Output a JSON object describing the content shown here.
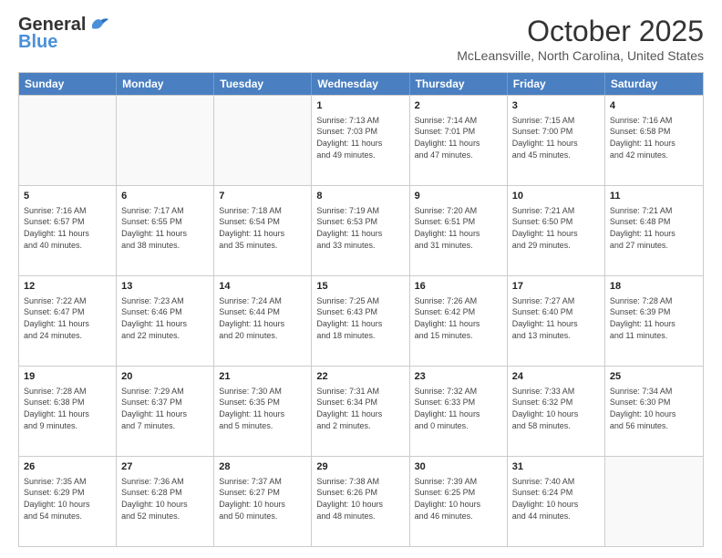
{
  "header": {
    "logo_line1": "General",
    "logo_line2": "Blue",
    "month_title": "October 2025",
    "location": "McLeansville, North Carolina, United States"
  },
  "weekdays": [
    "Sunday",
    "Monday",
    "Tuesday",
    "Wednesday",
    "Thursday",
    "Friday",
    "Saturday"
  ],
  "rows": [
    [
      {
        "day": "",
        "info": ""
      },
      {
        "day": "",
        "info": ""
      },
      {
        "day": "",
        "info": ""
      },
      {
        "day": "1",
        "info": "Sunrise: 7:13 AM\nSunset: 7:03 PM\nDaylight: 11 hours\nand 49 minutes."
      },
      {
        "day": "2",
        "info": "Sunrise: 7:14 AM\nSunset: 7:01 PM\nDaylight: 11 hours\nand 47 minutes."
      },
      {
        "day": "3",
        "info": "Sunrise: 7:15 AM\nSunset: 7:00 PM\nDaylight: 11 hours\nand 45 minutes."
      },
      {
        "day": "4",
        "info": "Sunrise: 7:16 AM\nSunset: 6:58 PM\nDaylight: 11 hours\nand 42 minutes."
      }
    ],
    [
      {
        "day": "5",
        "info": "Sunrise: 7:16 AM\nSunset: 6:57 PM\nDaylight: 11 hours\nand 40 minutes."
      },
      {
        "day": "6",
        "info": "Sunrise: 7:17 AM\nSunset: 6:55 PM\nDaylight: 11 hours\nand 38 minutes."
      },
      {
        "day": "7",
        "info": "Sunrise: 7:18 AM\nSunset: 6:54 PM\nDaylight: 11 hours\nand 35 minutes."
      },
      {
        "day": "8",
        "info": "Sunrise: 7:19 AM\nSunset: 6:53 PM\nDaylight: 11 hours\nand 33 minutes."
      },
      {
        "day": "9",
        "info": "Sunrise: 7:20 AM\nSunset: 6:51 PM\nDaylight: 11 hours\nand 31 minutes."
      },
      {
        "day": "10",
        "info": "Sunrise: 7:21 AM\nSunset: 6:50 PM\nDaylight: 11 hours\nand 29 minutes."
      },
      {
        "day": "11",
        "info": "Sunrise: 7:21 AM\nSunset: 6:48 PM\nDaylight: 11 hours\nand 27 minutes."
      }
    ],
    [
      {
        "day": "12",
        "info": "Sunrise: 7:22 AM\nSunset: 6:47 PM\nDaylight: 11 hours\nand 24 minutes."
      },
      {
        "day": "13",
        "info": "Sunrise: 7:23 AM\nSunset: 6:46 PM\nDaylight: 11 hours\nand 22 minutes."
      },
      {
        "day": "14",
        "info": "Sunrise: 7:24 AM\nSunset: 6:44 PM\nDaylight: 11 hours\nand 20 minutes."
      },
      {
        "day": "15",
        "info": "Sunrise: 7:25 AM\nSunset: 6:43 PM\nDaylight: 11 hours\nand 18 minutes."
      },
      {
        "day": "16",
        "info": "Sunrise: 7:26 AM\nSunset: 6:42 PM\nDaylight: 11 hours\nand 15 minutes."
      },
      {
        "day": "17",
        "info": "Sunrise: 7:27 AM\nSunset: 6:40 PM\nDaylight: 11 hours\nand 13 minutes."
      },
      {
        "day": "18",
        "info": "Sunrise: 7:28 AM\nSunset: 6:39 PM\nDaylight: 11 hours\nand 11 minutes."
      }
    ],
    [
      {
        "day": "19",
        "info": "Sunrise: 7:28 AM\nSunset: 6:38 PM\nDaylight: 11 hours\nand 9 minutes."
      },
      {
        "day": "20",
        "info": "Sunrise: 7:29 AM\nSunset: 6:37 PM\nDaylight: 11 hours\nand 7 minutes."
      },
      {
        "day": "21",
        "info": "Sunrise: 7:30 AM\nSunset: 6:35 PM\nDaylight: 11 hours\nand 5 minutes."
      },
      {
        "day": "22",
        "info": "Sunrise: 7:31 AM\nSunset: 6:34 PM\nDaylight: 11 hours\nand 2 minutes."
      },
      {
        "day": "23",
        "info": "Sunrise: 7:32 AM\nSunset: 6:33 PM\nDaylight: 11 hours\nand 0 minutes."
      },
      {
        "day": "24",
        "info": "Sunrise: 7:33 AM\nSunset: 6:32 PM\nDaylight: 10 hours\nand 58 minutes."
      },
      {
        "day": "25",
        "info": "Sunrise: 7:34 AM\nSunset: 6:30 PM\nDaylight: 10 hours\nand 56 minutes."
      }
    ],
    [
      {
        "day": "26",
        "info": "Sunrise: 7:35 AM\nSunset: 6:29 PM\nDaylight: 10 hours\nand 54 minutes."
      },
      {
        "day": "27",
        "info": "Sunrise: 7:36 AM\nSunset: 6:28 PM\nDaylight: 10 hours\nand 52 minutes."
      },
      {
        "day": "28",
        "info": "Sunrise: 7:37 AM\nSunset: 6:27 PM\nDaylight: 10 hours\nand 50 minutes."
      },
      {
        "day": "29",
        "info": "Sunrise: 7:38 AM\nSunset: 6:26 PM\nDaylight: 10 hours\nand 48 minutes."
      },
      {
        "day": "30",
        "info": "Sunrise: 7:39 AM\nSunset: 6:25 PM\nDaylight: 10 hours\nand 46 minutes."
      },
      {
        "day": "31",
        "info": "Sunrise: 7:40 AM\nSunset: 6:24 PM\nDaylight: 10 hours\nand 44 minutes."
      },
      {
        "day": "",
        "info": ""
      }
    ]
  ]
}
